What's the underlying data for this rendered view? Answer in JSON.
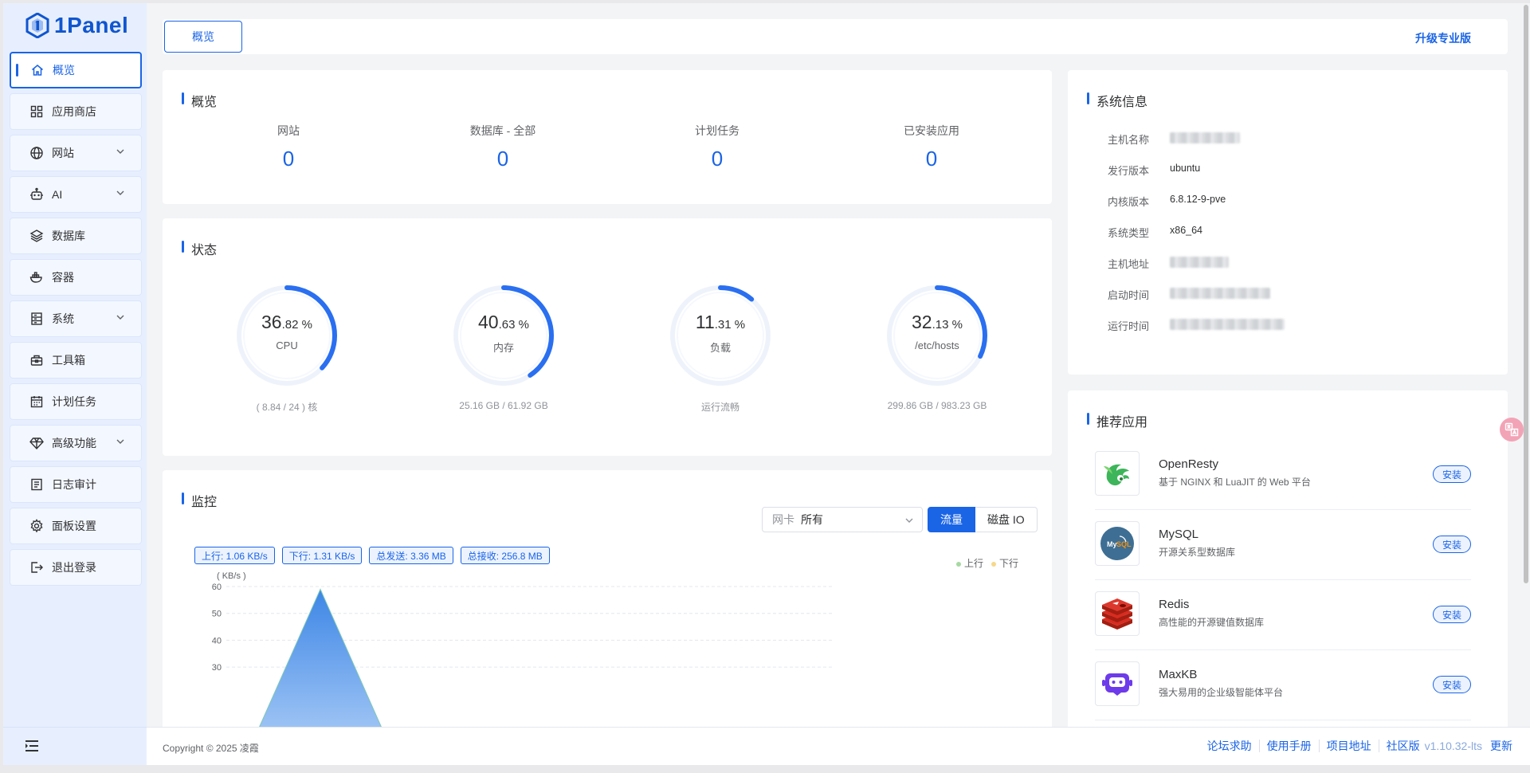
{
  "brand": {
    "name": "1Panel"
  },
  "sidebar": {
    "items": [
      {
        "label": "概览",
        "icon": "home-icon",
        "active": true
      },
      {
        "label": "应用商店",
        "icon": "grid-icon"
      },
      {
        "label": "网站",
        "icon": "globe-icon",
        "expandable": true
      },
      {
        "label": "AI",
        "icon": "robot-icon",
        "expandable": true
      },
      {
        "label": "数据库",
        "icon": "layers-icon"
      },
      {
        "label": "容器",
        "icon": "whale-icon"
      },
      {
        "label": "系统",
        "icon": "server-icon",
        "expandable": true
      },
      {
        "label": "工具箱",
        "icon": "toolbox-icon"
      },
      {
        "label": "计划任务",
        "icon": "calendar-icon"
      },
      {
        "label": "高级功能",
        "icon": "diamond-icon",
        "expandable": true
      },
      {
        "label": "日志审计",
        "icon": "log-icon"
      },
      {
        "label": "面板设置",
        "icon": "gear-icon"
      },
      {
        "label": "退出登录",
        "icon": "logout-icon"
      }
    ]
  },
  "topbar": {
    "tab": "概览",
    "upgrade": "升级专业版"
  },
  "overview": {
    "title": "概览",
    "items": [
      {
        "label": "网站",
        "value": "0"
      },
      {
        "label": "数据库 - 全部",
        "value": "0"
      },
      {
        "label": "计划任务",
        "value": "0"
      },
      {
        "label": "已安装应用",
        "value": "0"
      }
    ]
  },
  "status": {
    "title": "状态",
    "gauges": [
      {
        "int": "36",
        "dec": ".82",
        "unit": " %",
        "percent": 36.82,
        "label": "CPU",
        "sub": "( 8.84 / 24 ) 核"
      },
      {
        "int": "40",
        "dec": ".63",
        "unit": " %",
        "percent": 40.63,
        "label": "内存",
        "sub": "25.16 GB / 61.92 GB"
      },
      {
        "int": "11",
        "dec": ".31",
        "unit": " %",
        "percent": 11.31,
        "label": "负载",
        "sub": "运行流畅"
      },
      {
        "int": "32",
        "dec": ".13",
        "unit": " %",
        "percent": 32.13,
        "label": "/etc/hosts",
        "sub": "299.86 GB / 983.23 GB"
      }
    ]
  },
  "monitor": {
    "title": "监控",
    "nic_label": "网卡",
    "nic_value": "所有",
    "seg_traffic": "流量",
    "seg_disk": "磁盘 IO",
    "tags": [
      "上行: 1.06 KB/s",
      "下行: 1.31 KB/s",
      "总发送: 3.36 MB",
      "总接收: 256.8 MB"
    ],
    "legend_up": "上行",
    "legend_down": "下行",
    "colors": {
      "up": "#a6d9a0",
      "down": "#f5d88b",
      "fill": "#4a90e8"
    }
  },
  "chart_data": {
    "type": "area",
    "ylabel": "( KB/s )",
    "yticks": [
      30,
      40,
      50,
      60
    ],
    "ylim": [
      20,
      60
    ],
    "grid": true,
    "series": [
      {
        "name": "上行",
        "points": [
          [
            0,
            0
          ],
          [
            1,
            59
          ],
          [
            2,
            0
          ]
        ]
      }
    ]
  },
  "sysinfo": {
    "title": "系统信息",
    "rows": [
      {
        "key": "主机名称",
        "value": "",
        "blurred": true
      },
      {
        "key": "发行版本",
        "value": "ubuntu"
      },
      {
        "key": "内核版本",
        "value": "6.8.12-9-pve"
      },
      {
        "key": "系统类型",
        "value": "x86_64"
      },
      {
        "key": "主机地址",
        "value": "",
        "blurred": true
      },
      {
        "key": "启动时间",
        "value": "",
        "blurred": true
      },
      {
        "key": "运行时间",
        "value": "",
        "blurred": true
      }
    ]
  },
  "recommend": {
    "title": "推荐应用",
    "install_label": "安装",
    "apps": [
      {
        "name": "OpenResty",
        "desc": "基于 NGINX 和 LuaJIT 的 Web 平台",
        "icon": "openresty-icon"
      },
      {
        "name": "MySQL",
        "desc": "开源关系型数据库",
        "icon": "mysql-icon"
      },
      {
        "name": "Redis",
        "desc": "高性能的开源键值数据库",
        "icon": "redis-icon"
      },
      {
        "name": "MaxKB",
        "desc": "强大易用的企业级智能体平台",
        "icon": "maxkb-icon"
      }
    ]
  },
  "footer": {
    "copyright": "Copyright © 2025 凌霞",
    "links": [
      "论坛求助",
      "使用手册",
      "项目地址"
    ],
    "edition": "社区版",
    "version": "v1.10.32-lts",
    "update": "更新"
  },
  "float_button": {
    "icon": "translate-icon"
  }
}
